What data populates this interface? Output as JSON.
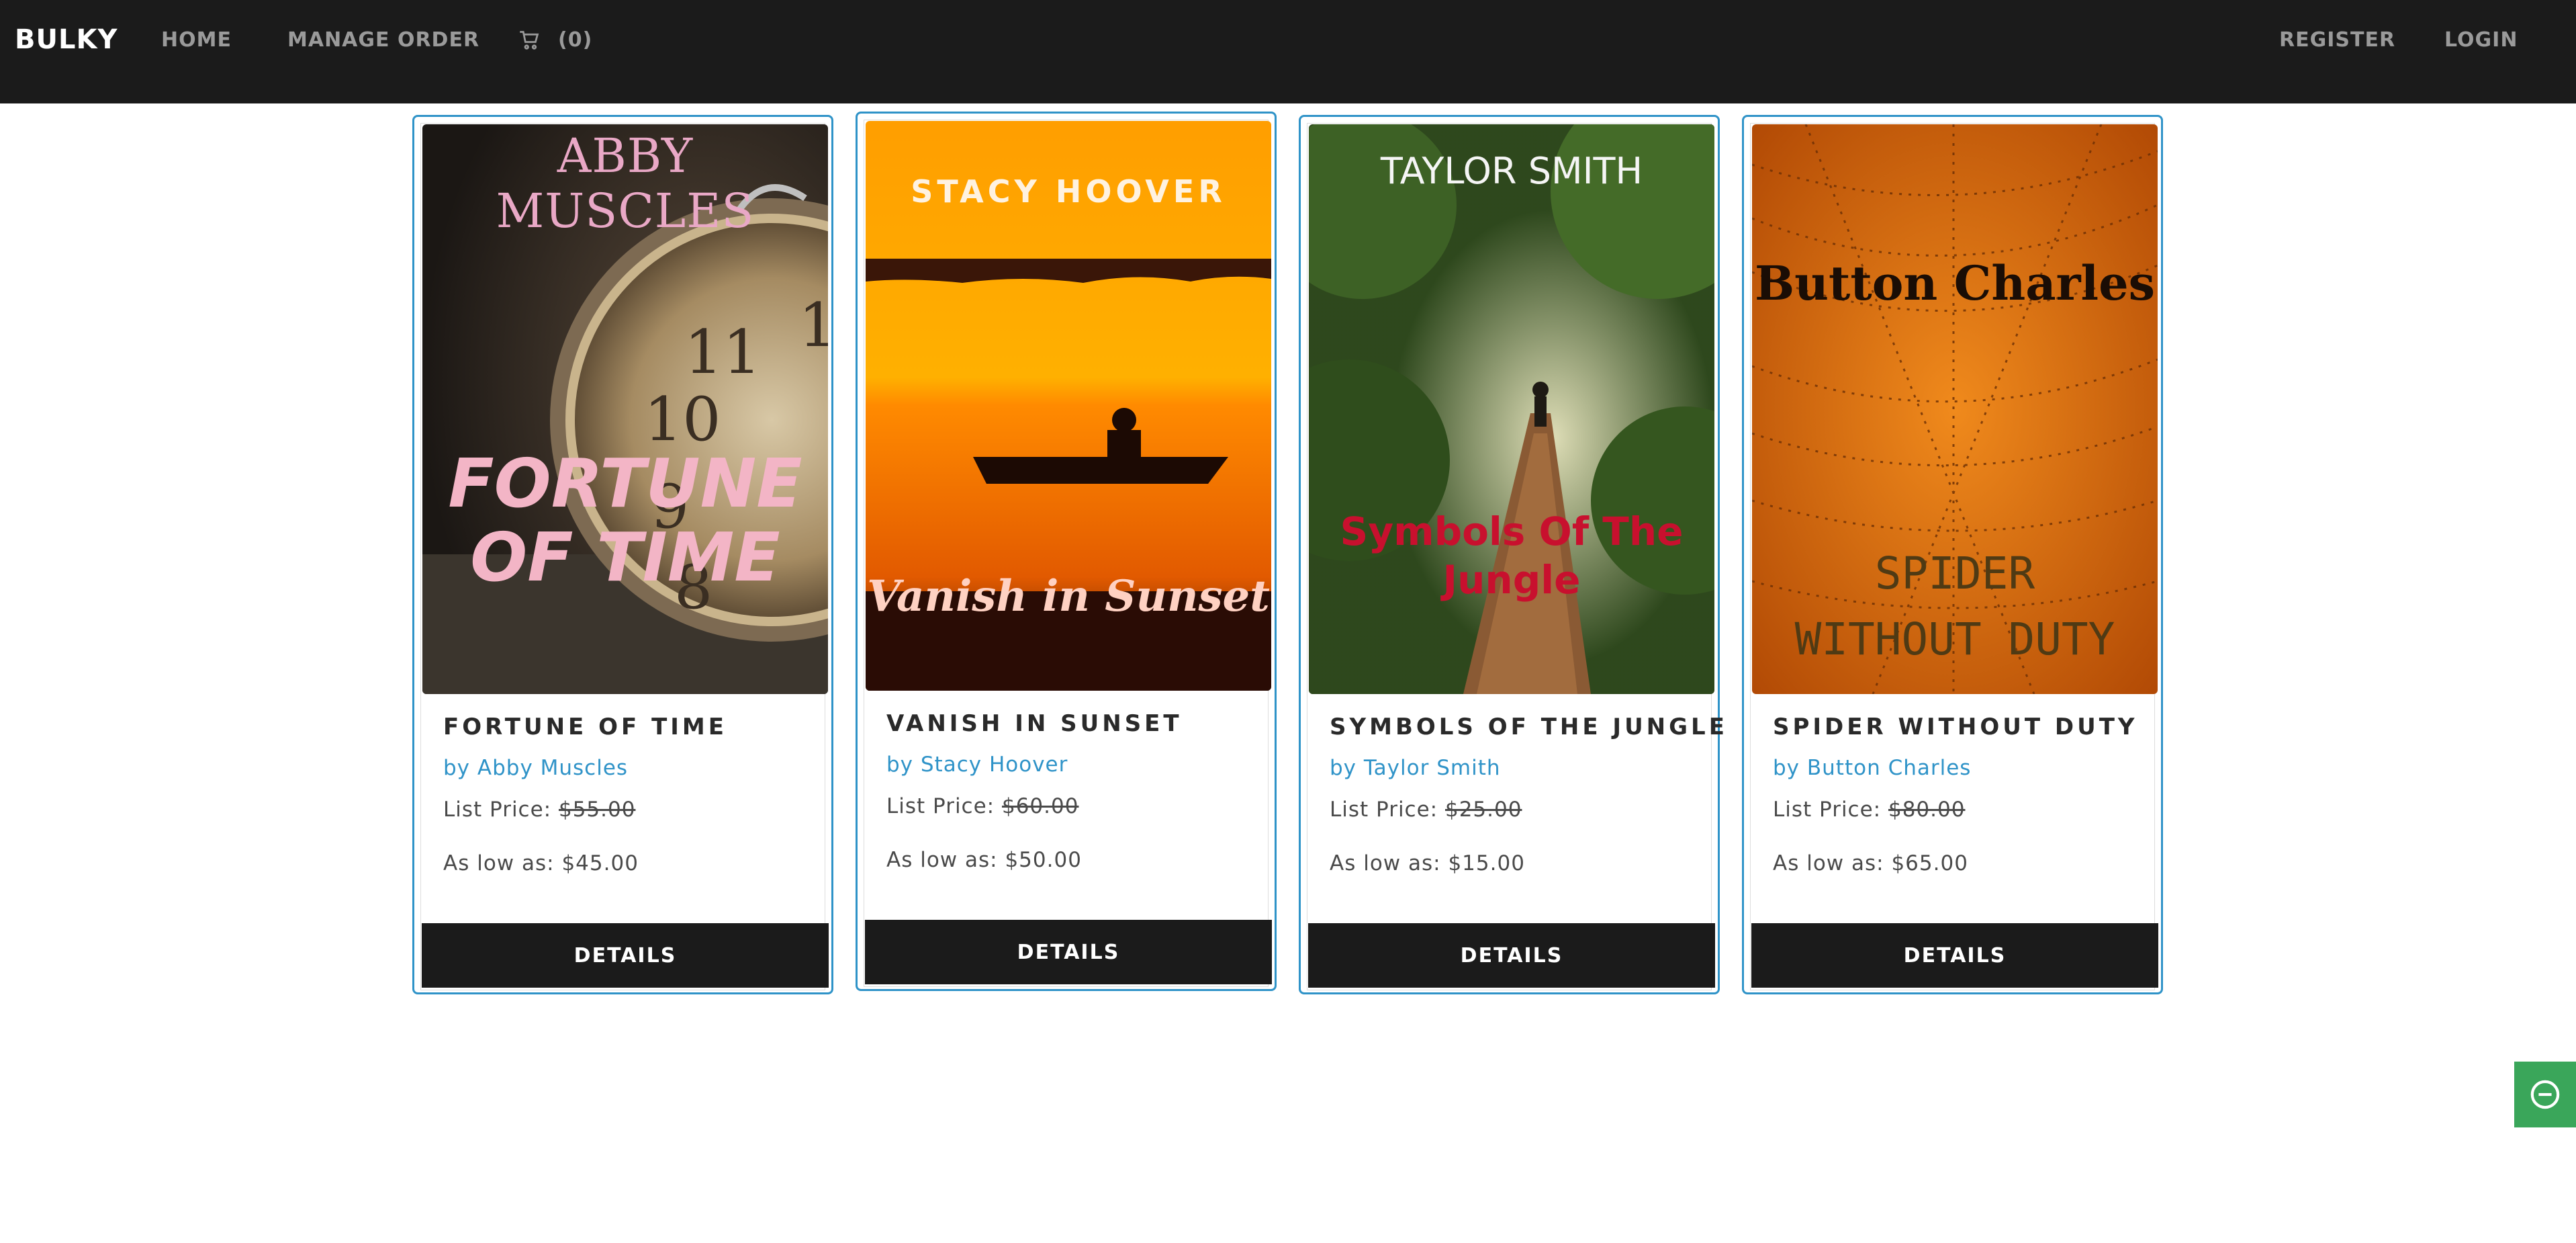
{
  "navbar": {
    "brand": "BULKY",
    "home": "HOME",
    "manage_order": "MANAGE ORDER",
    "cart_count": "(0)",
    "register": "REGISTER",
    "login": "LOGIN",
    "cart_icon": "shopping-cart-icon"
  },
  "books": [
    {
      "title": "FORTUNE OF TIME",
      "author": "by Abby Muscles",
      "list_price_label": "List Price:",
      "list_price": "$55.00",
      "low_price": "As low as: $45.00",
      "details": "DETAILS",
      "cover_author": "ABBY MUSCLES",
      "cover_title_line1": "FORTUNE",
      "cover_title_line2": "OF TIME"
    },
    {
      "title": "VANISH IN SUNSET",
      "author": "by Stacy Hoover",
      "list_price_label": "List Price:",
      "list_price": "$60.00",
      "low_price": "As low as: $50.00",
      "details": "DETAILS",
      "cover_author": "STACY HOOVER",
      "cover_title": "Vanish in Sunset"
    },
    {
      "title": "SYMBOLS OF THE JUNGLE",
      "author": "by Taylor Smith",
      "list_price_label": "List Price:",
      "list_price": "$25.00",
      "low_price": "As low as: $15.00",
      "details": "DETAILS",
      "cover_author": "TAYLOR SMITH",
      "cover_title_line1": "Symbols Of The",
      "cover_title_line2": "Jungle"
    },
    {
      "title": "SPIDER WITHOUT DUTY",
      "author": "by Button Charles",
      "list_price_label": "List Price:",
      "list_price": "$80.00",
      "low_price": "As low as: $65.00",
      "details": "DETAILS",
      "cover_author": "Button Charles",
      "cover_title_line1": "SPIDER",
      "cover_title_line2": "WITHOUT DUTY"
    }
  ],
  "colors": {
    "navbar_bg": "#1b1b1b",
    "accent": "#2f93c8",
    "button_bg": "#1b1b1b",
    "widget_bg": "#3aa65a"
  },
  "floating_widget": {
    "icon": "minus-circle-icon"
  }
}
